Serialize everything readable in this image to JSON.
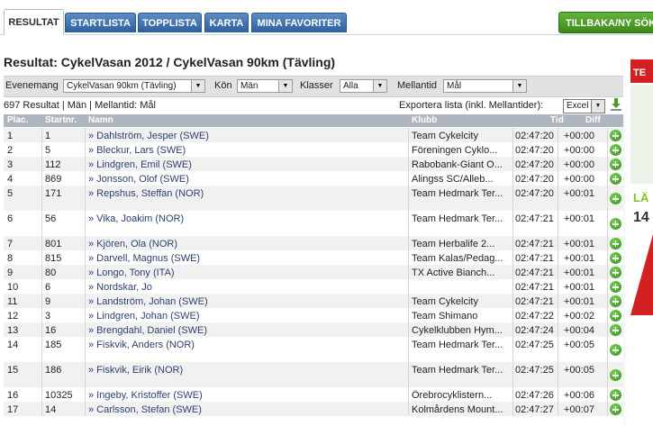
{
  "tabs": [
    {
      "label": "RESULTAT",
      "active": true
    },
    {
      "label": "STARTLISTA",
      "active": false
    },
    {
      "label": "TOPPLISTA",
      "active": false
    },
    {
      "label": "KARTA",
      "active": false
    },
    {
      "label": "MINA FAVORITER",
      "active": false
    }
  ],
  "back_button": "TILLBAKA/NY SÖK",
  "page_title": "Resultat: CykelVasan 2012 / CykelVasan 90km (Tävling)",
  "filters": {
    "event_label": "Evenemang",
    "event_value": "CykelVasan 90km (Tävling)",
    "gender_label": "Kön",
    "gender_value": "Män",
    "class_label": "Klasser",
    "class_value": "Alla",
    "split_label": "Mellantid",
    "split_value": "Mål"
  },
  "summary": "697 Resultat | Män | Mellantid: Mål",
  "export": {
    "label": "Exportera lista (inkl. Mellantider):",
    "value": "Excel",
    "icon": "download-icon"
  },
  "table": {
    "headers": {
      "plac": "Plac.",
      "start": "Startnr.",
      "name": "Namn",
      "club": "Klubb",
      "time": "Tid",
      "diff": "Diff"
    },
    "rows": [
      {
        "plac": "1",
        "start": "1",
        "name": "» Dahlström, Jesper (SWE)",
        "club": "Team Cykelcity",
        "time": "02:47:20",
        "diff": "+00:00"
      },
      {
        "plac": "2",
        "start": "5",
        "name": "» Bleckur, Lars (SWE)",
        "club": "Föreningen Cyklo...",
        "time": "02:47:20",
        "diff": "+00:00"
      },
      {
        "plac": "3",
        "start": "112",
        "name": "» Lindgren, Emil (SWE)",
        "club": "Rabobank-Giant O...",
        "time": "02:47:20",
        "diff": "+00:00"
      },
      {
        "plac": "4",
        "start": "869",
        "name": "» Jonsson, Olof (SWE)",
        "club": "Alingss SC/Alleb...",
        "time": "02:47:20",
        "diff": "+00:00"
      },
      {
        "plac": "5",
        "start": "171",
        "name": "» Repshus, Steffan (NOR)",
        "club": "Team Hedmark Ter...",
        "time": "02:47:20",
        "diff": "+00:01"
      },
      {
        "plac": "6",
        "start": "56",
        "name": "» Vika, Joakim (NOR)",
        "club": "Team Hedmark Ter...",
        "time": "02:47:21",
        "diff": "+00:01"
      },
      {
        "plac": "7",
        "start": "801",
        "name": "» Kjören, Ola (NOR)",
        "club": "Team Herbalife 2...",
        "time": "02:47:21",
        "diff": "+00:01"
      },
      {
        "plac": "8",
        "start": "815",
        "name": "» Darvell, Magnus (SWE)",
        "club": "Team Kalas/Pedag...",
        "time": "02:47:21",
        "diff": "+00:01"
      },
      {
        "plac": "9",
        "start": "80",
        "name": "» Longo, Tony (ITA)",
        "club": "TX Active Bianch...",
        "time": "02:47:21",
        "diff": "+00:01"
      },
      {
        "plac": "10",
        "start": "6",
        "name": "» Nordskar, Jo",
        "club": "",
        "time": "02:47:21",
        "diff": "+00:01"
      },
      {
        "plac": "11",
        "start": "9",
        "name": "» Landström, Johan (SWE)",
        "club": "Team Cykelcity",
        "time": "02:47:21",
        "diff": "+00:01"
      },
      {
        "plac": "12",
        "start": "3",
        "name": "» Lindgren, Johan (SWE)",
        "club": "Team Shimano",
        "time": "02:47:22",
        "diff": "+00:02"
      },
      {
        "plac": "13",
        "start": "16",
        "name": "» Brengdahl, Daniel (SWE)",
        "club": "Cykelklubben Hym...",
        "time": "02:47:24",
        "diff": "+00:04"
      },
      {
        "plac": "14",
        "start": "185",
        "name": "» Fiskvik, Anders (NOR)",
        "club": "Team Hedmark Ter...",
        "time": "02:47:25",
        "diff": "+00:05"
      },
      {
        "plac": "15",
        "start": "186",
        "name": "» Fiskvik, Eirik (NOR)",
        "club": "Team Hedmark Ter...",
        "time": "02:47:25",
        "diff": "+00:05"
      },
      {
        "plac": "16",
        "start": "10325",
        "name": "» Ingeby, Kristoffer (SWE)",
        "club": "Örebrocyklistern...",
        "time": "02:47:26",
        "diff": "+00:06"
      },
      {
        "plac": "17",
        "start": "14",
        "name": "» Carlsson, Stefan (SWE)",
        "club": "Kolmårdens Mount...",
        "time": "02:47:27",
        "diff": "+00:07"
      }
    ],
    "row_action_icon": "add-favorite-icon"
  },
  "ad": {
    "text": "TE",
    "text2": "LÄ",
    "text3": "14",
    "brand_color": "#d32020",
    "accent_color": "#7fbf1f"
  }
}
